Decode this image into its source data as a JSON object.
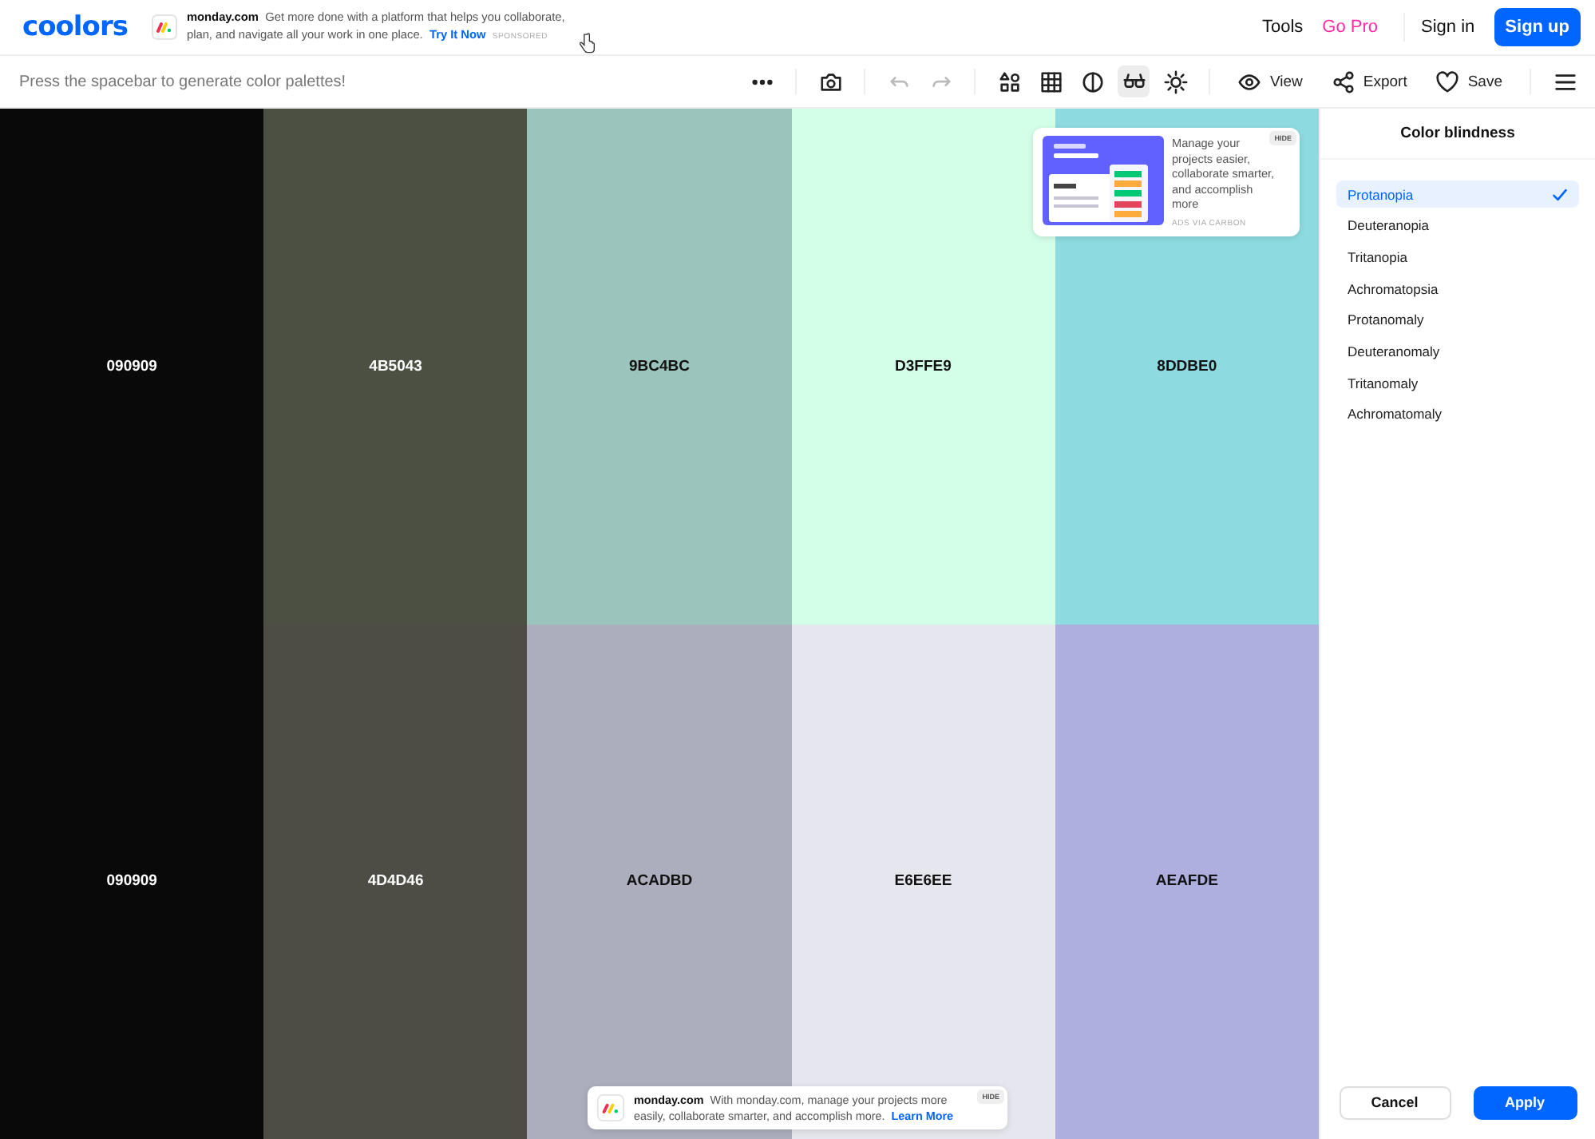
{
  "header": {
    "logo": "coolors",
    "ad": {
      "brand": "monday.com",
      "text": "Get more done with a platform that helps you collaborate, plan, and navigate all your work in one place.",
      "link": "Try It Now",
      "label": "SPONSORED"
    },
    "nav": [
      {
        "label": "Tools",
        "kind": "plain"
      },
      {
        "label": "Go Pro",
        "kind": "pro"
      },
      {
        "label": "Sign in",
        "kind": "plain"
      },
      {
        "label": "Sign up",
        "kind": "primary"
      }
    ]
  },
  "toolbar": {
    "hint": "Press the spacebar to generate color palettes!",
    "tools": [
      {
        "kind": "more",
        "selected": false,
        "disabled": false
      },
      {
        "kind": "camera",
        "selected": false,
        "disabled": false
      },
      {
        "kind": "undo",
        "selected": false,
        "disabled": true
      },
      {
        "kind": "redo",
        "selected": false,
        "disabled": true
      },
      {
        "kind": "shapes",
        "selected": false,
        "disabled": false
      },
      {
        "kind": "grid",
        "selected": false,
        "disabled": false
      },
      {
        "kind": "contrast",
        "selected": false,
        "disabled": false
      },
      {
        "kind": "glasses",
        "selected": true,
        "disabled": false
      },
      {
        "kind": "sun",
        "selected": false,
        "disabled": false
      }
    ],
    "actions": [
      {
        "label": "View",
        "kind": "eye"
      },
      {
        "label": "Export",
        "kind": "share"
      },
      {
        "label": "Save",
        "kind": "heart"
      }
    ]
  },
  "palettes": [
    [
      {
        "hex": "090909",
        "color": "#090909"
      },
      {
        "hex": "4B5043",
        "color": "#4b5043"
      },
      {
        "hex": "9BC4BC",
        "color": "#9bc4bc"
      },
      {
        "hex": "D3FFE9",
        "color": "#d3ffe9"
      },
      {
        "hex": "8DDBE0",
        "color": "#8ddbe0"
      }
    ],
    [
      {
        "hex": "090909",
        "color": "#090909"
      },
      {
        "hex": "4D4D46",
        "color": "#4d4d46"
      },
      {
        "hex": "ACADBD",
        "color": "#acadbd"
      },
      {
        "hex": "E6E6EE",
        "color": "#e6e6ee"
      },
      {
        "hex": "AEAFDE",
        "color": "#aeafde"
      }
    ]
  ],
  "carbon_ad": {
    "kind": "picture",
    "text": "Manage your projects easier, collaborate smarter, and accomplish more",
    "credit": "ADS VIA CARBON",
    "hide": "HIDE"
  },
  "bottom_ad": {
    "brand": "monday.com",
    "text": "With monday.com, manage your projects more easily, collaborate smarter, and accomplish more.",
    "link": "Learn More",
    "hide": "HIDE"
  },
  "sidebar": {
    "title": "Color blindness",
    "options": [
      {
        "label": "Protanopia",
        "selected": true
      },
      {
        "label": "Deuteranopia",
        "selected": false
      },
      {
        "label": "Tritanopia",
        "selected": false
      },
      {
        "label": "Achromatopsia",
        "selected": false
      },
      {
        "label": "Protanomaly",
        "selected": false
      },
      {
        "label": "Deuteranomaly",
        "selected": false
      },
      {
        "label": "Tritanomaly",
        "selected": false
      },
      {
        "label": "Achromatomaly",
        "selected": false
      }
    ],
    "buttons": [
      {
        "label": "Cancel",
        "kind": "secondary"
      },
      {
        "label": "Apply",
        "kind": "primary"
      }
    ]
  }
}
